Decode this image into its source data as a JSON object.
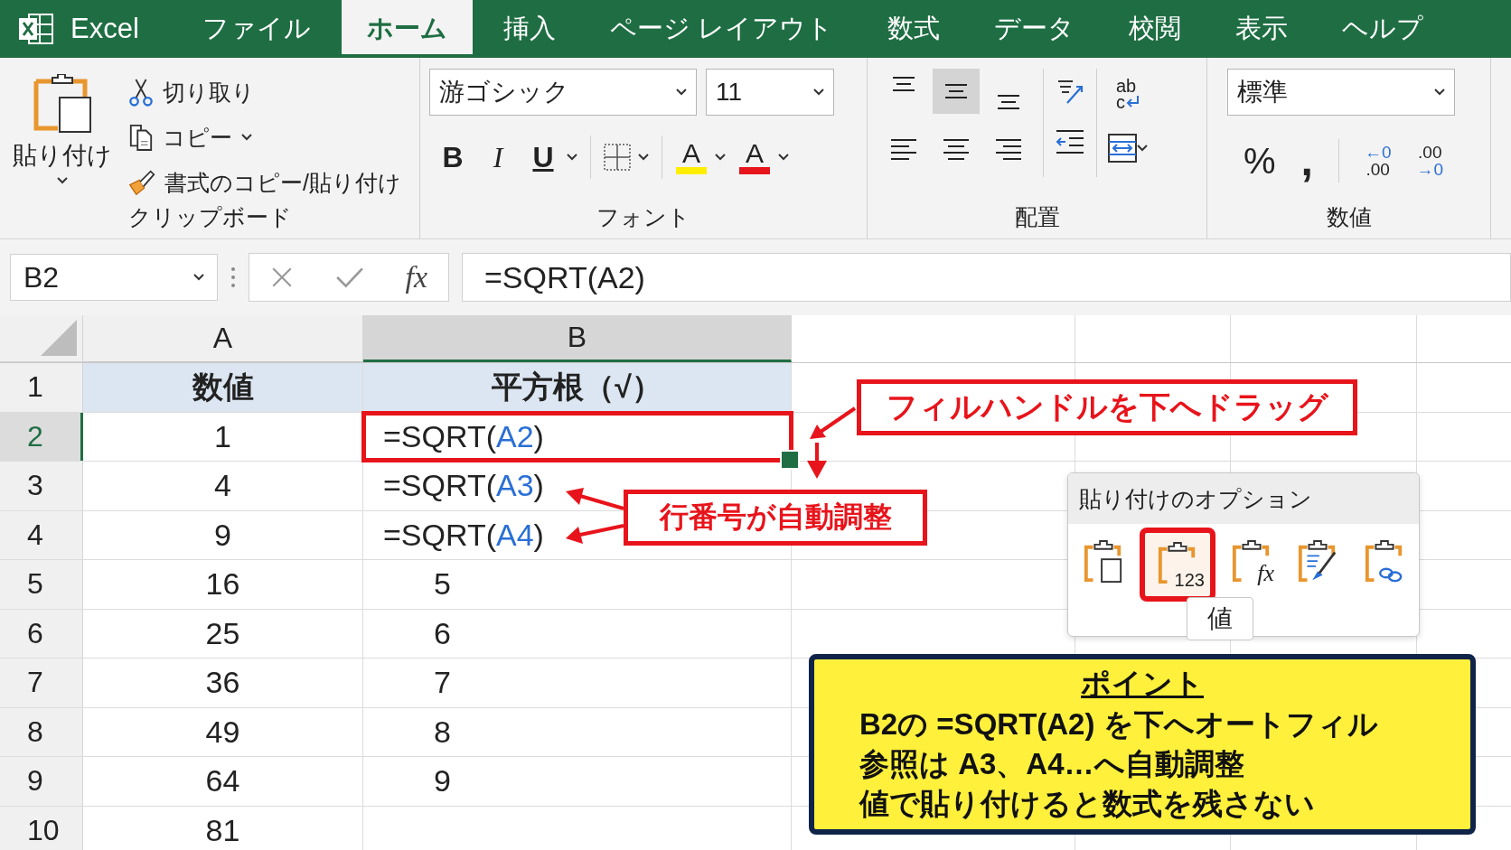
{
  "app": {
    "name": "Excel"
  },
  "tabs": [
    {
      "label": "ファイル",
      "selected": false
    },
    {
      "label": "ホーム",
      "selected": true
    },
    {
      "label": "挿入",
      "selected": false
    },
    {
      "label": "ページ レイアウト",
      "selected": false
    },
    {
      "label": "数式",
      "selected": false
    },
    {
      "label": "データ",
      "selected": false
    },
    {
      "label": "校閲",
      "selected": false
    },
    {
      "label": "表示",
      "selected": false
    },
    {
      "label": "ヘルプ",
      "selected": false
    }
  ],
  "ribbon": {
    "clipboard": {
      "paste": "貼り付け",
      "cut": "切り取り",
      "copy": "コピー",
      "format_painter": "書式のコピー/貼り付け",
      "label": "クリップボード"
    },
    "font": {
      "font_name": "游ゴシック",
      "font_size": "11",
      "bold": "B",
      "italic": "I",
      "underline": "U",
      "highlight": {
        "label": "A",
        "color": "#ffee00"
      },
      "font_color": {
        "label": "A",
        "color": "#e8141b"
      },
      "label": "フォント"
    },
    "alignment": {
      "buttons": [
        {
          "kind": "top",
          "selected": false
        },
        {
          "kind": "middle",
          "selected": true
        },
        {
          "kind": "bottom",
          "selected": false
        },
        {
          "kind": "left",
          "selected": false
        },
        {
          "kind": "center",
          "selected": false
        },
        {
          "kind": "right",
          "selected": false
        }
      ],
      "wrap": [
        "ab",
        "c"
      ],
      "label": "配置"
    },
    "number": {
      "format": "標準",
      "percent": "%",
      "comma": ",",
      "decimal_left": [
        "←0",
        ".00"
      ],
      "decimal_right": [
        ".00",
        "→0"
      ],
      "label": "数値"
    }
  },
  "formula_bar": {
    "name_box": "B2",
    "fx": "fx",
    "formula": "=SQRT(A2)"
  },
  "sheet": {
    "columns": [
      {
        "label": "A",
        "selected": false
      },
      {
        "label": "B",
        "selected": true
      }
    ],
    "rows": [
      {
        "number": "1",
        "selected": false,
        "cells": [
          {
            "kind": "header",
            "text": "数値"
          },
          {
            "kind": "header",
            "text": "平方根（√）"
          }
        ]
      },
      {
        "number": "2",
        "selected": true,
        "cells": [
          {
            "kind": "number",
            "text": "1"
          },
          {
            "kind": "formula",
            "before": "=SQRT(",
            "ref": "A2",
            "after": ")",
            "active": true
          }
        ]
      },
      {
        "number": "3",
        "selected": false,
        "cells": [
          {
            "kind": "number",
            "text": "4"
          },
          {
            "kind": "formula",
            "before": "=SQRT(",
            "ref": "A3",
            "after": ")",
            "active": false
          }
        ]
      },
      {
        "number": "4",
        "selected": false,
        "cells": [
          {
            "kind": "number",
            "text": "9"
          },
          {
            "kind": "formula",
            "before": "=SQRT(",
            "ref": "A4",
            "after": ")",
            "active": false
          }
        ]
      },
      {
        "number": "5",
        "selected": false,
        "cells": [
          {
            "kind": "number",
            "text": "16"
          },
          {
            "kind": "value",
            "text": "5"
          }
        ]
      },
      {
        "number": "6",
        "selected": false,
        "cells": [
          {
            "kind": "number",
            "text": "25"
          },
          {
            "kind": "value",
            "text": "6"
          }
        ]
      },
      {
        "number": "7",
        "selected": false,
        "cells": [
          {
            "kind": "number",
            "text": "36"
          },
          {
            "kind": "value",
            "text": "7"
          }
        ]
      },
      {
        "number": "8",
        "selected": false,
        "cells": [
          {
            "kind": "number",
            "text": "49"
          },
          {
            "kind": "value",
            "text": "8"
          }
        ]
      },
      {
        "number": "9",
        "selected": false,
        "cells": [
          {
            "kind": "number",
            "text": "64"
          },
          {
            "kind": "value",
            "text": "9"
          }
        ]
      },
      {
        "number": "10",
        "selected": false,
        "cells": [
          {
            "kind": "number",
            "text": "81"
          }
        ]
      }
    ]
  },
  "annotations": {
    "fill_callout": "フィルハンドルを下へドラッグ",
    "row_callout": "行番号が自動調整"
  },
  "paste_options": {
    "title": "貼り付けのオプション",
    "options": [
      {
        "kind": "paste",
        "selected": false
      },
      {
        "kind": "values",
        "label": "123",
        "selected": true
      },
      {
        "kind": "formulas",
        "label": "fx",
        "selected": false
      },
      {
        "kind": "formatting",
        "selected": false
      },
      {
        "kind": "link",
        "selected": false
      }
    ],
    "tooltip": "値"
  },
  "point": {
    "title": "ポイント",
    "lines": [
      "B2の =SQRT(A2) を下へオートフィル",
      "参照は A3、A4…へ自動調整",
      "値で貼り付けると数式を残さない"
    ]
  }
}
